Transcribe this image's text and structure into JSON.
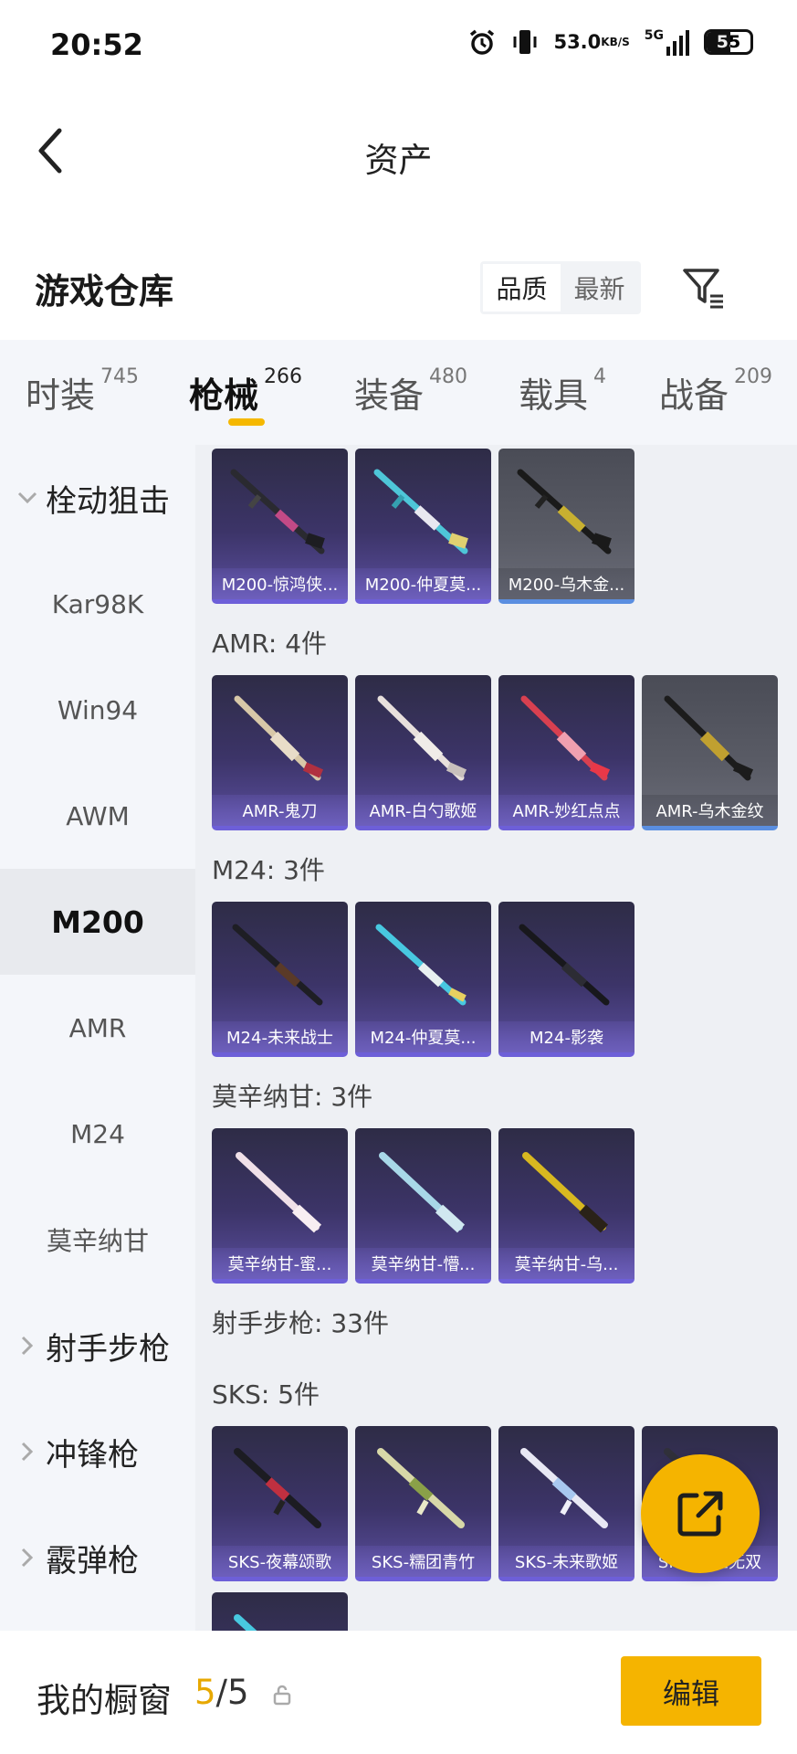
{
  "status_bar": {
    "time": "20:52",
    "speed_value": "53.0",
    "speed_unit": "KB/S",
    "network": "5G",
    "battery": "55",
    "icons": [
      "alarm-icon",
      "vibrate-icon",
      "signal-icon",
      "battery-icon"
    ]
  },
  "nav": {
    "title": "资产",
    "back_icon": "chevron-left-icon"
  },
  "warehouse": {
    "title": "游戏仓库",
    "sort_options": [
      "品质",
      "最新"
    ],
    "sort_selected": "品质",
    "filter_icon": "filter-icon"
  },
  "tabs": [
    {
      "label": "时装",
      "count": "745",
      "active": false
    },
    {
      "label": "枪械",
      "count": "266",
      "active": true
    },
    {
      "label": "装备",
      "count": "480",
      "active": false
    },
    {
      "label": "载具",
      "count": "4",
      "active": false
    },
    {
      "label": "战备",
      "count": "209",
      "active": false
    }
  ],
  "sidebar": {
    "group_open": "栓动狙击",
    "items": [
      "Kar98K",
      "Win94",
      "AWM",
      "M200",
      "AMR",
      "M24",
      "莫辛纳甘"
    ],
    "selected": "M200",
    "groups_closed": [
      "射手步枪",
      "冲锋枪",
      "霰弹枪"
    ]
  },
  "sections": {
    "m200_cards": [
      "M200-惊鸿侠...",
      "M200-仲夏莫...",
      "M200-乌木金..."
    ],
    "amr_label": "AMR: 4件",
    "amr_cards": [
      "AMR-鬼刀",
      "AMR-白勺歌姬",
      "AMR-妙红点点",
      "AMR-乌木金纹"
    ],
    "m24_label": "M24: 3件",
    "m24_cards": [
      "M24-未来战士",
      "M24-仲夏莫...",
      "M24-影袭"
    ],
    "mosin_label": "莫辛纳甘: 3件",
    "mosin_cards": [
      "莫辛纳甘-蜜...",
      "莫辛纳甘-懵...",
      "莫辛纳甘-乌..."
    ],
    "dmr_label": "射手步枪: 33件",
    "sks_label": "SKS: 5件",
    "sks_cards": [
      "SKS-夜幕颂歌",
      "SKS-糯团青竹",
      "SKS-未来歌姬",
      "SKS-绝世无双"
    ]
  },
  "fab": {
    "icon": "share-external-icon"
  },
  "bottom_bar": {
    "title": "我的橱窗",
    "count_current": "5",
    "count_sep": "/5",
    "lock_icon": "lock-icon",
    "edit_label": "编辑"
  },
  "colors": {
    "accent": "#f5b400",
    "card_purple": "#3c3468",
    "card_gray": "#5a5c66",
    "page_bg": "#eef0f4"
  }
}
